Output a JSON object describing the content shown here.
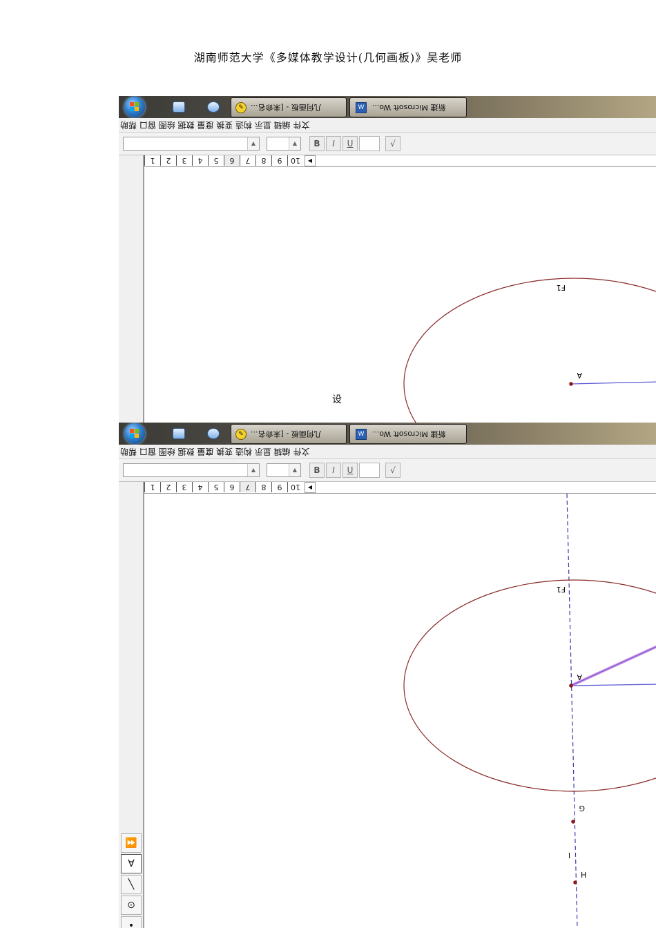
{
  "document": {
    "title": "湖南师范大学《多媒体教学设计(几何画板)》吴老师",
    "caption": "设"
  },
  "taskbar": {
    "app_button_label": "几何画板 - [未命名...",
    "word_button_label": "新建 Microsoft Wo..."
  },
  "menubar": {
    "label": "文件 编辑 显示 构造 变换 度量 数据 绘图 窗口 帮助"
  },
  "toolbar": {
    "bold_label": "B",
    "italic_label": "I",
    "underline_label": "U"
  },
  "pages": {
    "tabs": [
      "1",
      "2",
      "3",
      "4",
      "5",
      "6",
      "7",
      "8",
      "9",
      "10"
    ],
    "active_tab_shot1": "6",
    "active_tab_shot2": "7"
  },
  "canvas": {
    "ellipse_label": "F1",
    "point_a": "A",
    "point_g": "G",
    "point_h": "H",
    "line_i": "l"
  },
  "colors": {
    "ellipse": "#8b2a2a",
    "segment": "#5a5ad6",
    "dashed_line": "#3a3aa8",
    "highlight": "#c26ad8",
    "point": "#8b1a1a"
  },
  "tools": [
    "arrow-tool",
    "point-tool",
    "compass-tool",
    "segment-tool",
    "select-tool"
  ]
}
